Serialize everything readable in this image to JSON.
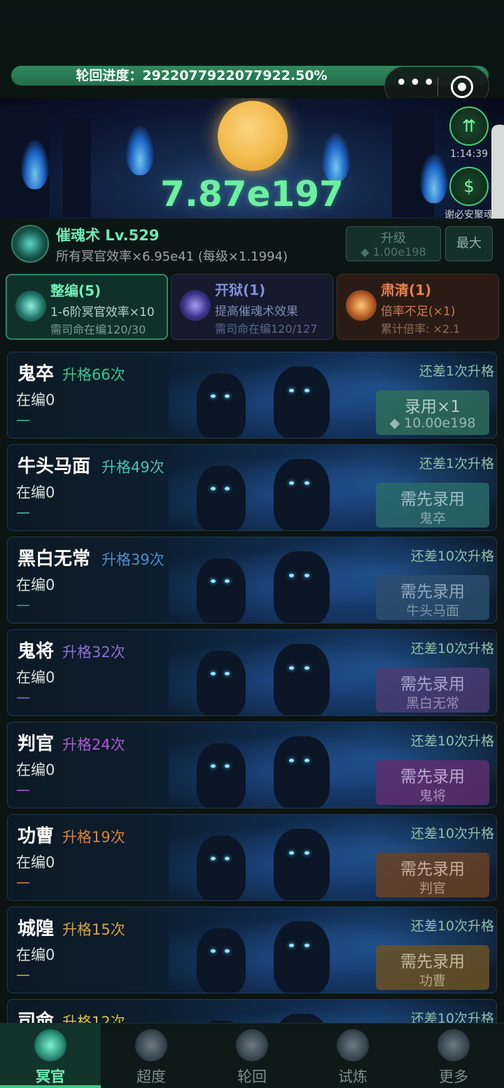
{
  "progress": {
    "label": "轮回进度：2922077922077922.50%",
    "percent": 100
  },
  "hero": {
    "value": "7.87e197",
    "timer": "1:14:39",
    "sponsor_label": "谢必安聚魂"
  },
  "skill": {
    "name": "催魂术 Lv.529",
    "desc": "所有冥官效率×6.95e41 (每级×1.1994)",
    "upgrade_label": "升级",
    "upgrade_cost": "◆ 1.00e198",
    "max_label": "最大"
  },
  "actions": [
    {
      "title": "整编(5)",
      "line1": "1-6阶冥官效率×10",
      "line2": "需司命在编120/30"
    },
    {
      "title": "开狱(1)",
      "line1": "提高催魂术效果",
      "line2": "需司命在编120/127"
    },
    {
      "title": "肃清(1)",
      "line1": "倍率不足(×1)",
      "line2": "累计倍率: ×2.1"
    }
  ],
  "units": [
    {
      "name": "鬼卒",
      "grade": "升格66次",
      "staff": "在编0",
      "dash": "—",
      "need": "还差1次升格",
      "btn_top": "录用×1",
      "btn_bottom": "◆ 10.00e198",
      "color": "#37c98d",
      "btn_bg": "#2e6e5c",
      "btn_fg": "#cfe9df"
    },
    {
      "name": "牛头马面",
      "grade": "升格49次",
      "staff": "在编0",
      "dash": "—",
      "need": "还差1次升格",
      "btn_top": "需先录用",
      "btn_bottom": "鬼卒",
      "color": "#46c3b4",
      "btn_bg": "#2a6a6a",
      "btn_fg": "#b7d9d6"
    },
    {
      "name": "黑白无常",
      "grade": "升格39次",
      "staff": "在编0",
      "dash": "—",
      "need": "还差10次升格",
      "btn_top": "需先录用",
      "btn_bottom": "牛头马面",
      "color": "#4a8fd0",
      "btn_bg": "#2c4e6e",
      "btn_fg": "#a9bfd3"
    },
    {
      "name": "鬼将",
      "grade": "升格32次",
      "staff": "在编0",
      "dash": "—",
      "need": "还差10次升格",
      "btn_top": "需先录用",
      "btn_bottom": "黑白无常",
      "color": "#8c6fd6",
      "btn_bg": "#4b3c73",
      "btn_fg": "#c6b9e2"
    },
    {
      "name": "判官",
      "grade": "升格24次",
      "staff": "在编0",
      "dash": "—",
      "need": "还差10次升格",
      "btn_top": "需先录用",
      "btn_bottom": "鬼将",
      "color": "#b25ad6",
      "btn_bg": "#5e3070",
      "btn_fg": "#dcbfe6"
    },
    {
      "name": "功曹",
      "grade": "升格19次",
      "staff": "在编0",
      "dash": "—",
      "need": "还差10次升格",
      "btn_top": "需先录用",
      "btn_bottom": "判官",
      "color": "#d9823e",
      "btn_bg": "#6a4125",
      "btn_fg": "#e6c7ae"
    },
    {
      "name": "城隍",
      "grade": "升格15次",
      "staff": "在编0",
      "dash": "—",
      "need": "还差10次升格",
      "btn_top": "需先录用",
      "btn_bottom": "功曹",
      "color": "#d9a33e",
      "btn_bg": "#6a5225",
      "btn_fg": "#e6d4ae"
    },
    {
      "name": "司命",
      "grade": "升格12次",
      "staff": "",
      "dash": "",
      "need": "还差10次升格",
      "btn_top": "",
      "btn_bottom": "",
      "color": "#d9c23e",
      "btn_bg": "#6a6025",
      "btn_fg": "#e6deae"
    }
  ],
  "nav": [
    {
      "label": "冥官",
      "icon": "ghost-mask-icon"
    },
    {
      "label": "超度",
      "icon": "shrine-icon"
    },
    {
      "label": "轮回",
      "icon": "cycle-icon"
    },
    {
      "label": "试炼",
      "icon": "flame-crest-icon"
    },
    {
      "label": "更多",
      "icon": "more-crest-icon"
    }
  ]
}
